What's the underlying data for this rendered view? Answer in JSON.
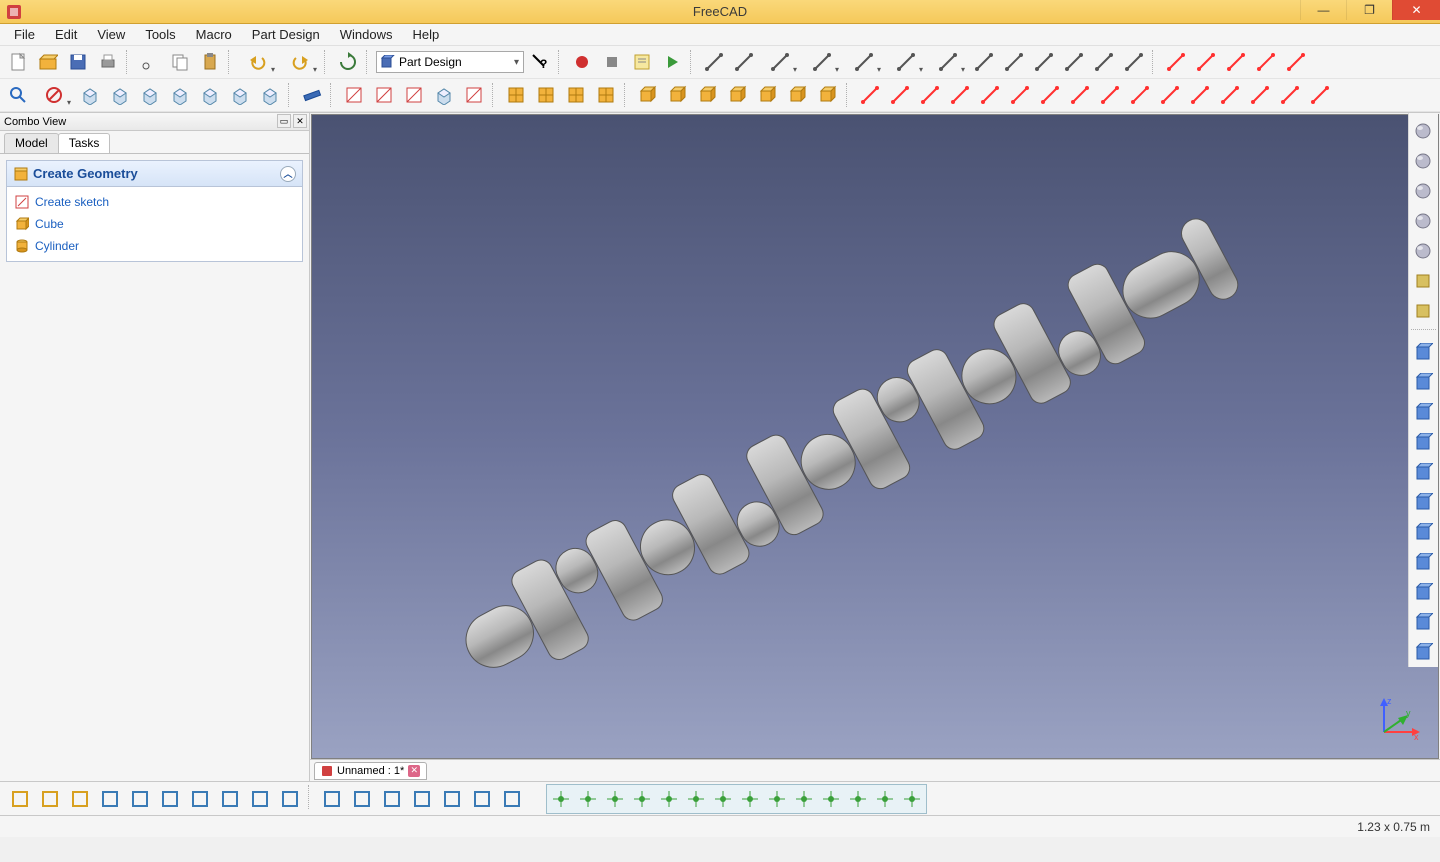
{
  "titlebar": {
    "app_name": "FreeCAD"
  },
  "menu": [
    "File",
    "Edit",
    "View",
    "Tools",
    "Macro",
    "Part Design",
    "Windows",
    "Help"
  ],
  "workbench": {
    "selected": "Part Design"
  },
  "combo": {
    "title": "Combo View",
    "tabs": [
      "Model",
      "Tasks"
    ],
    "active_tab": "Tasks",
    "task_header": "Create Geometry",
    "task_items": [
      {
        "icon": "sketch",
        "label": "Create sketch"
      },
      {
        "icon": "cube",
        "label": "Cube"
      },
      {
        "icon": "cylinder",
        "label": "Cylinder"
      }
    ]
  },
  "document": {
    "tab_label": "Unnamed : 1*"
  },
  "statusbar": {
    "dimensions": "1.23 x 0.75 m"
  },
  "axis": {
    "x": "x",
    "y": "y",
    "z": "z"
  },
  "toolbar_row1_names": [
    "new-file",
    "open-file",
    "save-file",
    "print",
    "sep",
    "cut",
    "copy",
    "paste",
    "sep",
    "undo-dd",
    "redo-dd",
    "sep",
    "refresh",
    "sep",
    "workbench-select",
    "whats-this",
    "sep",
    "macro-record",
    "macro-stop",
    "macro-edit",
    "macro-run",
    "sep",
    "sketch-point",
    "sketch-line",
    "sketch-polyline-dd",
    "sketch-arc-dd",
    "sketch-circle-dd",
    "sketch-conic-dd",
    "sketch-polygon-dd",
    "sketch-slot",
    "sketch-fillet",
    "sketch-trim",
    "sketch-construction",
    "sketch-external",
    "sketch-extend",
    "sep",
    "constr-point",
    "constr-vertical",
    "constr-horizontal",
    "constr-parallel",
    "constr-perpendicular"
  ],
  "toolbar_row2_names": [
    "fit-all",
    "clear-selection-dd",
    "view-iso",
    "view-front",
    "view-top",
    "view-right",
    "view-rear",
    "view-bottom",
    "view-left",
    "sep",
    "measure",
    "sep",
    "leave-sketch",
    "import-sketch",
    "export-sketch",
    "view-sketch",
    "map-sketch",
    "sep",
    "show-grid",
    "show-layers",
    "show-constraints",
    "toggle-construction",
    "sep",
    "part-box",
    "part-cylinder",
    "part-sphere",
    "part-cone",
    "part-torus",
    "part-prism",
    "part-wedge",
    "sep",
    "const-coincident",
    "const-pointonobj",
    "const-vertical",
    "const-horizontal",
    "const-parallel",
    "const-perpendicular",
    "const-tangent",
    "const-equal",
    "const-symmetric",
    "const-lock",
    "const-horiz-dist",
    "const-vert-dist",
    "const-length",
    "const-radius",
    "const-angle",
    "const-snell"
  ],
  "right_tb_names": [
    "appearance-sphere",
    "appearance-grey",
    "appearance-glass",
    "appearance-ring",
    "appearance-gold",
    "dim-vertical",
    "bot-icon",
    "sep",
    "op-revolve",
    "op-extrude",
    "op-loft",
    "op-mirror",
    "op-thickness-out",
    "op-thickness-in",
    "op-face-red",
    "op-face-blue",
    "op-sweep",
    "op-draft",
    "op-shell"
  ],
  "bottom_left_names": [
    "draft-wire",
    "draft-text",
    "draft-shapestring",
    "draft-box",
    "draft-move",
    "draft-rotate",
    "draft-offset",
    "draft-up",
    "draft-down",
    "draft-grid",
    "sep",
    "draft-trimex",
    "draft-extrude",
    "draft-array",
    "draft-pointarray",
    "draft-scale",
    "draft-clone",
    "draft-edit"
  ],
  "bottom_group_names": [
    "snap-lock",
    "snap-midpoint",
    "snap-perp",
    "snap-grid",
    "snap-intersect",
    "snap-parallel",
    "snap-endpoint",
    "snap-angle",
    "snap-center",
    "snap-extension",
    "snap-near",
    "snap-ortho",
    "snap-dimensions",
    "snap-workingplane"
  ]
}
